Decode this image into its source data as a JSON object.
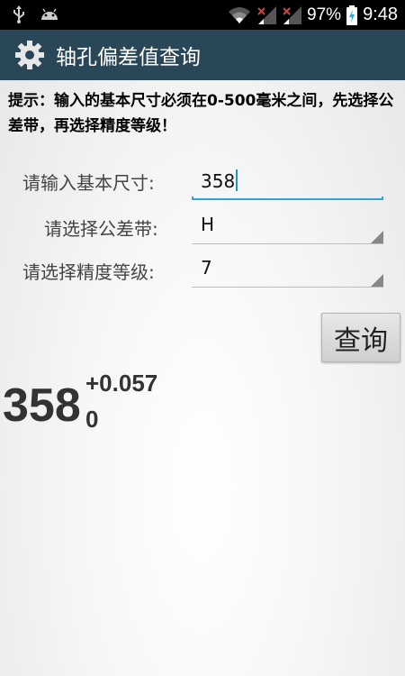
{
  "status_bar": {
    "icons": [
      "usb-icon",
      "android-icon",
      "wifi-icon",
      "signal-1-icon",
      "signal-2-icon",
      "battery-charging-icon"
    ],
    "battery": "97%",
    "time": "9:48"
  },
  "app_bar": {
    "icon": "gear-icon",
    "title": "轴孔偏差值查询"
  },
  "hint": "提示：输入的基本尺寸必须在0-500毫米之间，先选择公差带，再选择精度等级！",
  "form": {
    "size_label": "请输入基本尺寸:",
    "size_value": "358",
    "tolerance_label": "请选择公差带:",
    "tolerance_value": "H",
    "grade_label": "请选择精度等级:",
    "grade_value": "7"
  },
  "query_button": "查询",
  "result": {
    "base": "358",
    "upper": "+0.057",
    "lower": "0"
  },
  "colors": {
    "app_bar": "#2a4758",
    "input_accent": "#33a3d9"
  }
}
